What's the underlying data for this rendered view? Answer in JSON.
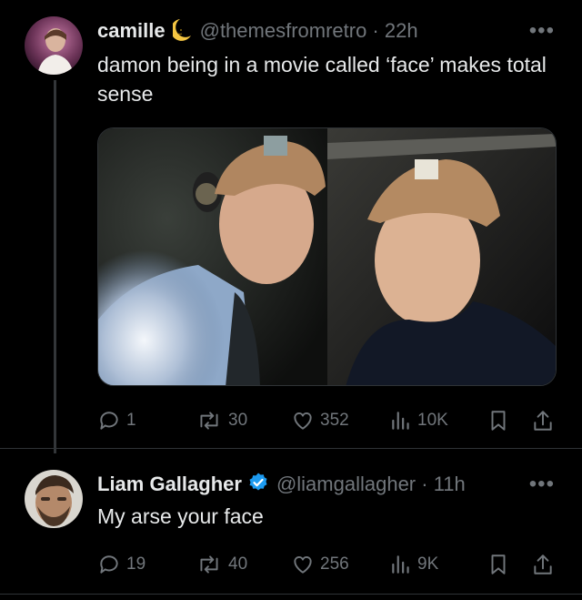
{
  "tweets": [
    {
      "name": "camille",
      "badge_icon": "crescent-moon-emoji",
      "handle_time": "@themesfromretro · 22h",
      "text": "damon being in a movie called ‘face’ makes total sense",
      "more": "•••",
      "stats": {
        "replies": "1",
        "retweets": "30",
        "likes": "352",
        "views": "10K"
      }
    },
    {
      "name": "Liam Gallagher",
      "badge_icon": "verified-badge-icon",
      "handle_time": "@liamgallagher · 11h",
      "text": "My arse your face",
      "more": "•••",
      "stats": {
        "replies": "19",
        "retweets": "40",
        "likes": "256",
        "views": "9K"
      }
    }
  ],
  "colors": {
    "background": "#000000",
    "text": "#e7e9ea",
    "muted": "#71767b",
    "verified": "#1d9bf0",
    "border": "#2f3336"
  }
}
